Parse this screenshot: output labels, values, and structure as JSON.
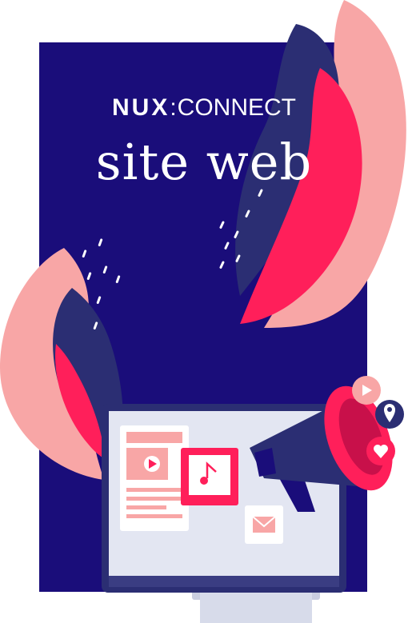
{
  "brand": {
    "logo_part1": "NUX",
    "logo_separator": ":",
    "logo_part2": "CONNECT",
    "title": "site web"
  },
  "colors": {
    "background_panel": "#1a0d7a",
    "accent_red": "#ff1f5a",
    "accent_pink": "#f8a6a6",
    "navy": "#2b2e73",
    "screen": "#e3e6f2"
  },
  "icons": [
    "play-icon",
    "music-note-icon",
    "mail-icon",
    "megaphone-icon",
    "location-pin-icon",
    "heart-icon",
    "monitor-icon"
  ]
}
